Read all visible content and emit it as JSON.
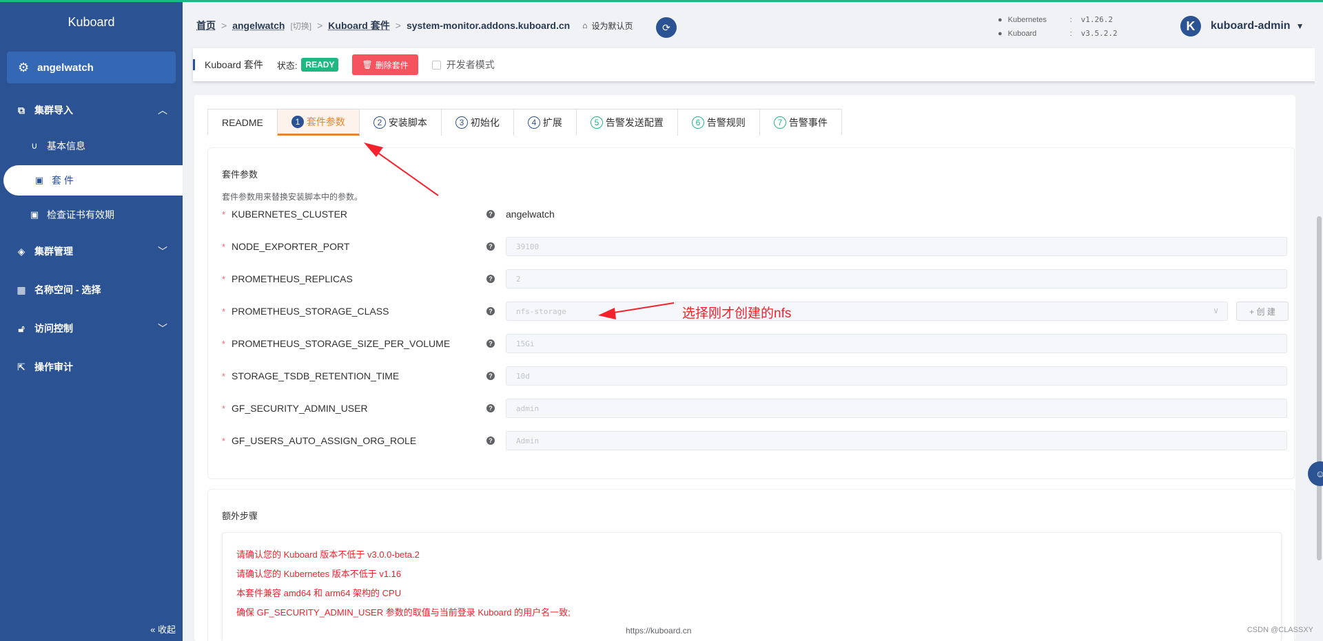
{
  "sidebar": {
    "brand": "Kuboard",
    "cluster": "angelwatch",
    "items": [
      {
        "label": "集群导入"
      },
      {
        "label": "基本信息"
      },
      {
        "label": "套 件"
      },
      {
        "label": "检查证书有效期"
      },
      {
        "label": "集群管理"
      },
      {
        "label": "名称空间 - 选择"
      },
      {
        "label": "访问控制"
      },
      {
        "label": "操作审计"
      }
    ],
    "collapse": "收起"
  },
  "header": {
    "breadcrumb": {
      "home": "首页",
      "cluster": "angelwatch",
      "switch": "[切换]",
      "suite": "Kuboard 套件",
      "current": "system-monitor.addons.kuboard.cn",
      "set_default": "设为默认页"
    },
    "versions": [
      {
        "name": "Kubernetes",
        "value": "v1.26.2"
      },
      {
        "name": "Kuboard",
        "value": "v3.5.2.2"
      }
    ],
    "user": {
      "avatar": "K",
      "name": "kuboard-admin"
    }
  },
  "toolbar": {
    "title": "Kuboard 套件",
    "status_label": "状态:",
    "status": "READY",
    "delete_label": "删除套件",
    "dev_mode": "开发者模式"
  },
  "tabs": [
    {
      "label": "README"
    },
    {
      "num": "1",
      "label": "套件参数",
      "active": true
    },
    {
      "num": "2",
      "label": "安装脚本"
    },
    {
      "num": "3",
      "label": "初始化"
    },
    {
      "num": "4",
      "label": "扩展"
    },
    {
      "num": "5",
      "label": "告警发送配置"
    },
    {
      "num": "6",
      "label": "告警规则"
    },
    {
      "num": "7",
      "label": "告警事件"
    }
  ],
  "params": {
    "title": "套件参数",
    "desc": "套件参数用来替换安装脚本中的参数。",
    "rows": [
      {
        "name": "KUBERNETES_CLUSTER",
        "value": "angelwatch"
      },
      {
        "name": "NODE_EXPORTER_PORT",
        "value": "39100"
      },
      {
        "name": "PROMETHEUS_REPLICAS",
        "value": "2"
      },
      {
        "name": "PROMETHEUS_STORAGE_CLASS",
        "value": "nfs-storage"
      },
      {
        "name": "PROMETHEUS_STORAGE_SIZE_PER_VOLUME",
        "value": "15Gi"
      },
      {
        "name": "STORAGE_TSDB_RETENTION_TIME",
        "value": "10d"
      },
      {
        "name": "GF_SECURITY_ADMIN_USER",
        "value": "admin"
      },
      {
        "name": "GF_USERS_AUTO_ASSIGN_ORG_ROLE",
        "value": "Admin"
      }
    ],
    "create_label": "+ 创 建"
  },
  "extra": {
    "title": "额外步骤",
    "lines": [
      "请确认您的 Kuboard 版本不低于 v3.0.0-beta.2",
      "请确认您的 Kubernetes 版本不低于 v1.16",
      "本套件兼容 amd64 和 arm64 架构的 CPU",
      "确保 GF_SECURITY_ADMIN_USER 参数的取值与当前登录 Kuboard 的用户名一致;"
    ]
  },
  "annotation": "选择刚才创建的nfs",
  "footer": {
    "url": "https://kuboard.cn",
    "watermark": "CSDN @CLASSXY"
  },
  "colors": {
    "sidebar": "#2b5394",
    "ready": "#1fb882",
    "danger": "#f5545f",
    "active_tab": "#e6862e",
    "annotation": "#f5222d"
  }
}
